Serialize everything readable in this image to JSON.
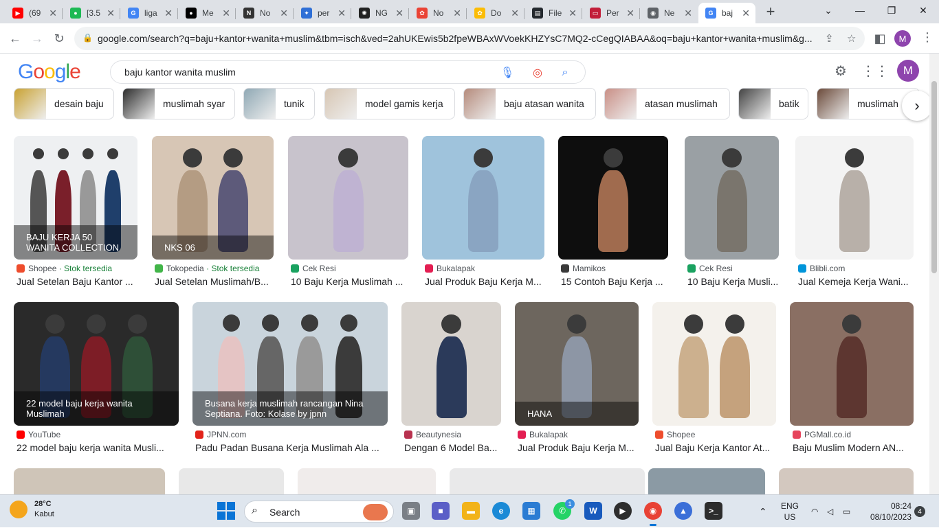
{
  "browser": {
    "tabs": [
      {
        "title": "(69",
        "fav_color": "#ff0000",
        "fav_glyph": "▶"
      },
      {
        "title": "[3.5",
        "fav_color": "#1db954",
        "fav_glyph": "●"
      },
      {
        "title": "liga",
        "fav_color": "#4285f4",
        "fav_glyph": "G"
      },
      {
        "title": "Me",
        "fav_color": "#000000",
        "fav_glyph": "●"
      },
      {
        "title": "No",
        "fav_color": "#333333",
        "fav_glyph": "N"
      },
      {
        "title": "per",
        "fav_color": "#2f6fd6",
        "fav_glyph": "✦"
      },
      {
        "title": "NG",
        "fav_color": "#222222",
        "fav_glyph": "✺"
      },
      {
        "title": "No",
        "fav_color": "#ea4335",
        "fav_glyph": "✿"
      },
      {
        "title": "Do",
        "fav_color": "#fbbc05",
        "fav_glyph": "✿"
      },
      {
        "title": "File",
        "fav_color": "#24292e",
        "fav_glyph": "▤"
      },
      {
        "title": "Per",
        "fav_color": "#c21e3a",
        "fav_glyph": "▭"
      },
      {
        "title": "Ne",
        "fav_color": "#5f6368",
        "fav_glyph": "◉"
      },
      {
        "title": "baj",
        "fav_color": "#4285f4",
        "fav_glyph": "G"
      }
    ],
    "url": "google.com/search?q=baju+kantor+wanita+muslim&tbm=isch&ved=2ahUKEwis5b2fpeWBAxWVoekKHZYsC7MQ2-cCegQIABAA&oq=baju+kantor+wanita+muslim&g...",
    "profile_initial": "M"
  },
  "google": {
    "logo_letters": [
      "G",
      "o",
      "o",
      "g",
      "l",
      "e"
    ],
    "logo_colors": [
      "#4285f4",
      "#ea4335",
      "#fbbc05",
      "#4285f4",
      "#34a853",
      "#ea4335"
    ],
    "query": "baju kantor wanita muslim",
    "avatar_initial": "M",
    "chips": [
      {
        "label": "desain baju"
      },
      {
        "label": "muslimah syar"
      },
      {
        "label": "tunik"
      },
      {
        "label": "model gamis kerja"
      },
      {
        "label": "baju atasan wanita"
      },
      {
        "label": "atasan muslimah"
      },
      {
        "label": "batik"
      },
      {
        "label": "muslimah"
      }
    ],
    "results_row1": [
      {
        "source": "Shopee",
        "stock": "· Stok tersedia",
        "title": "Jual Setelan Baju Kantor ...",
        "src_color": "#ee4d2d",
        "overlay": "BAJU KERJA 50 WANITA COLLECTION"
      },
      {
        "source": "Tokopedia",
        "stock": "· Stok tersedia",
        "title": "Jual Setelan Muslimah/B...",
        "src_color": "#42b549",
        "overlay": "NKS 06"
      },
      {
        "source": "Cek Resi",
        "stock": "",
        "title": "10 Baju Kerja Muslimah ...",
        "src_color": "#1aa260",
        "overlay": ""
      },
      {
        "source": "Bukalapak",
        "stock": "",
        "title": "Jual Produk Baju Kerja M...",
        "src_color": "#e31e52",
        "overlay": ""
      },
      {
        "source": "Mamikos",
        "stock": "",
        "title": "15 Contoh Baju Kerja ...",
        "src_color": "#3a3a3a",
        "overlay": ""
      },
      {
        "source": "Cek Resi",
        "stock": "",
        "title": "10 Baju Kerja Musli...",
        "src_color": "#1aa260",
        "overlay": ""
      },
      {
        "source": "Blibli.com",
        "stock": "",
        "title": "Jual Kemeja Kerja Wani...",
        "src_color": "#0095da",
        "overlay": ""
      }
    ],
    "results_row2": [
      {
        "source": "YouTube",
        "title": "22 model baju kerja wanita Musli...",
        "src_color": "#ff0000",
        "overlay": "22 model baju kerja wanita Muslimah"
      },
      {
        "source": "JPNN.com",
        "title": "Padu Padan Busana Kerja Muslimah Ala ...",
        "src_color": "#e2231a",
        "overlay": "Busana kerja muslimah rancangan Nina Septiana. Foto: Kolase by jpnn"
      },
      {
        "source": "Beautynesia",
        "title": "Dengan 6 Model Ba...",
        "src_color": "#b8324f",
        "overlay": ""
      },
      {
        "source": "Bukalapak",
        "title": "Jual Produk Baju Kerja M...",
        "src_color": "#e31e52",
        "overlay": "HANA"
      },
      {
        "source": "Shopee",
        "title": "Jual Baju Kerja Kantor At...",
        "src_color": "#ee4d2d",
        "overlay": ""
      },
      {
        "source": "PGMall.co.id",
        "title": "Baju Muslim Modern AN...",
        "src_color": "#e6445c",
        "overlay": ""
      }
    ]
  },
  "taskbar": {
    "temp": "28°C",
    "weather": "Kabut",
    "search_label": "Search",
    "lang_line1": "ENG",
    "lang_line2": "US",
    "time": "08:24",
    "date": "08/10/2023",
    "notifications": "4",
    "whatsapp_badge": "1"
  }
}
